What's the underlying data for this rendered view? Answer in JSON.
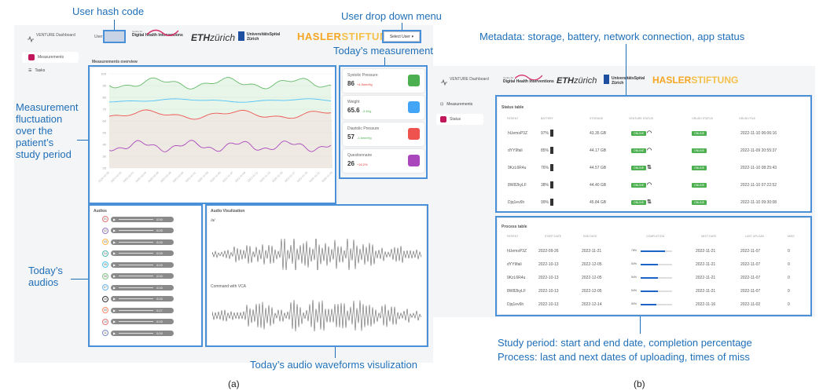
{
  "left": {
    "app_title": "VENTURE Dashboard",
    "user_label": "User",
    "select_user": "Select User",
    "logos": {
      "dhi_small": "Centre for",
      "dhi_main": "Digital Health Interventions",
      "eth_a": "ETH",
      "eth_b": "zürich",
      "usz_a": "UniversitätsSpital",
      "usz_b": "Zürich",
      "hasler_a": "HASLER",
      "hasler_b": "STIFTUNG"
    },
    "sidebar": [
      "Measurements",
      "Tasks"
    ],
    "overview_title": "Measurements overview",
    "y_ticks": [
      "100",
      "90",
      "80",
      "70",
      "60",
      "50",
      "40",
      "30",
      "20"
    ],
    "x_ticks": [
      "2022-10-18",
      "2022-10-20",
      "2022-10-22",
      "2022-10-24",
      "2022-10-26",
      "2022-10-28",
      "2022-10-30",
      "2022-11-01",
      "2022-11-03",
      "2022-11-05",
      "2022-11-07",
      "2022-11-09",
      "2022-11-11",
      "2022-11-13",
      "2022-11-15",
      "2022-11-17",
      "2022-11-19",
      "2022-11-21",
      "2022-11-23"
    ],
    "today_cards": [
      {
        "label": "Systolic Pressure",
        "value": "86",
        "delta": "+4.5mmHg",
        "delta_color": "#e53935",
        "icon_color": "#4caf50"
      },
      {
        "label": "Weight",
        "value": "65.6",
        "delta": "-3.4Kg",
        "delta_color": "#4caf50",
        "icon_color": "#42a5f5"
      },
      {
        "label": "Diastolic Pressure",
        "value": "57",
        "delta": "-1.6mmHg",
        "delta_color": "#4caf50",
        "icon_color": "#ef5350"
      },
      {
        "label": "Questionnaire",
        "value": "26",
        "delta": "+16.2%",
        "delta_color": "#e53935",
        "icon_color": "#ab47bc"
      }
    ],
    "audios_title": "Audios",
    "audios": [
      {
        "n": "01",
        "color": "#e57373",
        "time": "0:00"
      },
      {
        "n": "02",
        "color": "#9575cd",
        "time": "0:00"
      },
      {
        "n": "03",
        "color": "#ffb74d",
        "time": "0:00"
      },
      {
        "n": "04",
        "color": "#4db6ac",
        "time": "0:00"
      },
      {
        "n": "05",
        "color": "#4fc3f7",
        "time": "0:00"
      },
      {
        "n": "06",
        "color": "#81c784",
        "time": "0:00"
      },
      {
        "n": "07",
        "color": "#64b5f6",
        "time": "0:00"
      },
      {
        "n": "08",
        "color": "#333333",
        "time": "0:00"
      },
      {
        "n": "09",
        "color": "#ff8a65",
        "time": "0:17"
      },
      {
        "n": "10",
        "color": "#e57373",
        "time": "0:00"
      },
      {
        "n": "11",
        "color": "#7986cb",
        "time": "0:00"
      }
    ],
    "viz_title": "Audio Visulization",
    "viz_label_1": "/a/",
    "viz_label_2": "Command with VCA"
  },
  "right": {
    "app_title": "VENTURE Dashboard",
    "sidebar": [
      "Measurements",
      "Status"
    ],
    "status_title": "Status table",
    "status_headers": [
      "PATIENT",
      "BATTERY",
      "STORAGE",
      "VENTURE STATUS",
      "ORUSH STATUS",
      "ORUSH FILE"
    ],
    "status_rows": [
      {
        "patient": "hUemsP3Z",
        "battery": "97%",
        "storage": "43.35 GB",
        "conn": "wifi",
        "venture": "ONLINE",
        "orush": "ONLINE",
        "file": "2022-11-10 06:06:16"
      },
      {
        "patient": "dYY9fali",
        "battery": "85%",
        "storage": "44.17 GB",
        "conn": "wifi",
        "venture": "ONLINE",
        "orush": "ONLINE",
        "file": "2022-11-09 20:55:37"
      },
      {
        "patient": "9KzL6R4u",
        "battery": "76%",
        "storage": "44.57 GB",
        "conn": "cell",
        "venture": "ONLINE",
        "orush": "ONLINE",
        "file": "2022-11-10 08:25:43"
      },
      {
        "patient": "8W82kyLF",
        "battery": "38%",
        "storage": "44.40 GB",
        "conn": "wifi",
        "venture": "ONLINE",
        "orush": "ONLINE",
        "file": "2022-11-10 07:22:52"
      },
      {
        "patient": "Djq1ev6h",
        "battery": "99%",
        "storage": "45.84 GB",
        "conn": "cell",
        "venture": "ONLINE",
        "orush": "ONLINE",
        "file": "2022-11-10 09:30:08"
      }
    ],
    "process_title": "Process table",
    "process_headers": [
      "PATIENT",
      "START DATE",
      "END DATE",
      "COMPLETION",
      "NEXT DATE",
      "LAST UPLOAD",
      "MISS"
    ],
    "process_rows": [
      {
        "patient": "hUemsP3Z",
        "start": "2022-09-26",
        "end": "2022-11-21",
        "pct": "78%",
        "frac": 0.78,
        "next": "2022-11-21",
        "last": "2022-11-07",
        "miss": "0"
      },
      {
        "patient": "dYY9fali",
        "start": "2022-10-13",
        "end": "2022-12-05",
        "pct": "54%",
        "frac": 0.54,
        "next": "2022-11-21",
        "last": "2022-11-07",
        "miss": "0"
      },
      {
        "patient": "9KzL6R4u",
        "start": "2022-10-13",
        "end": "2022-12-05",
        "pct": "54%",
        "frac": 0.54,
        "next": "2022-11-21",
        "last": "2022-11-07",
        "miss": "0"
      },
      {
        "patient": "8W82kyLF",
        "start": "2022-10-13",
        "end": "2022-12-05",
        "pct": "54%",
        "frac": 0.54,
        "next": "2022-11-21",
        "last": "2022-11-07",
        "miss": "0"
      },
      {
        "patient": "Djq1ev6h",
        "start": "2022-10-13",
        "end": "2022-12-14",
        "pct": "50%",
        "frac": 0.5,
        "next": "2022-11-16",
        "last": "2022-11-02",
        "miss": "0"
      }
    ]
  },
  "annotations": {
    "user_hash": "User hash code",
    "user_dropdown": "User drop down menu",
    "todays_measurement": "Today’s measurement",
    "fluctuation": [
      "Measurement",
      "fluctuation",
      "over the",
      "patient’s",
      "study period"
    ],
    "todays_audios": [
      "Today’s",
      "audios"
    ],
    "waveforms": "Today’s audio waveforms visulization",
    "metadata": "Metadata: storage, battery, network connection, app status",
    "study_period": "Study period: start and end date, completion percentage",
    "process": "Process: last and next dates of uploading, times of miss",
    "caption_a": "(a)",
    "caption_b": "(b)"
  },
  "colors": {
    "annotation_blue": "#1f6fb8",
    "box_blue": "#4a90d9",
    "green_line": "#66bb6a",
    "cyan_line": "#4fc3f7",
    "red_line": "#ef5350",
    "purple_line": "#ab47bc",
    "hasler_yellow": "#f5a623"
  }
}
